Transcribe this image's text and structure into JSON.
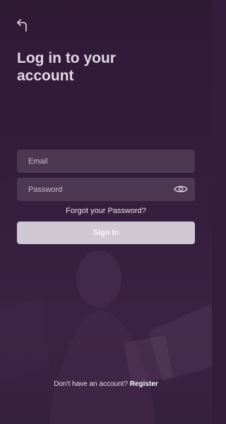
{
  "title": "Log in to your account",
  "form": {
    "email_placeholder": "Email",
    "email_value": "",
    "password_placeholder": "Password",
    "password_value": "",
    "forgot_label": "Forgot your Password?",
    "signin_label": "Sign In"
  },
  "footer": {
    "prompt": "Don't have an account?",
    "register_label": "Register"
  },
  "icons": {
    "back": "back-arrow-icon",
    "show_password": "eye-icon"
  },
  "colors": {
    "background": "#341d3c",
    "title": "#e1d7e3",
    "button": "#d0c9d3"
  }
}
